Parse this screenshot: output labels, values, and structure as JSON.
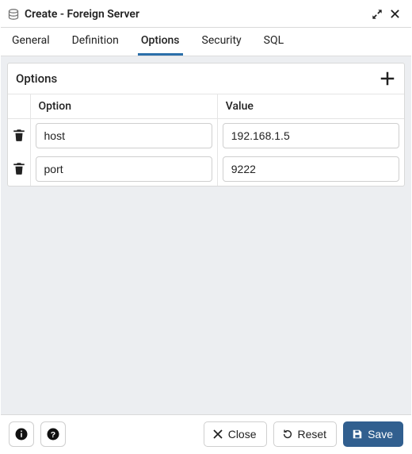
{
  "header": {
    "title": "Create - Foreign Server"
  },
  "tabs": {
    "items": [
      {
        "label": "General",
        "active": false
      },
      {
        "label": "Definition",
        "active": false
      },
      {
        "label": "Options",
        "active": true
      },
      {
        "label": "Security",
        "active": false
      },
      {
        "label": "SQL",
        "active": false
      }
    ]
  },
  "options_panel": {
    "title": "Options",
    "columns": {
      "option": "Option",
      "value": "Value"
    },
    "rows": [
      {
        "option": "host",
        "value": "192.168.1.5"
      },
      {
        "option": "port",
        "value": "9222"
      }
    ]
  },
  "footer": {
    "close": "Close",
    "reset": "Reset",
    "save": "Save"
  }
}
